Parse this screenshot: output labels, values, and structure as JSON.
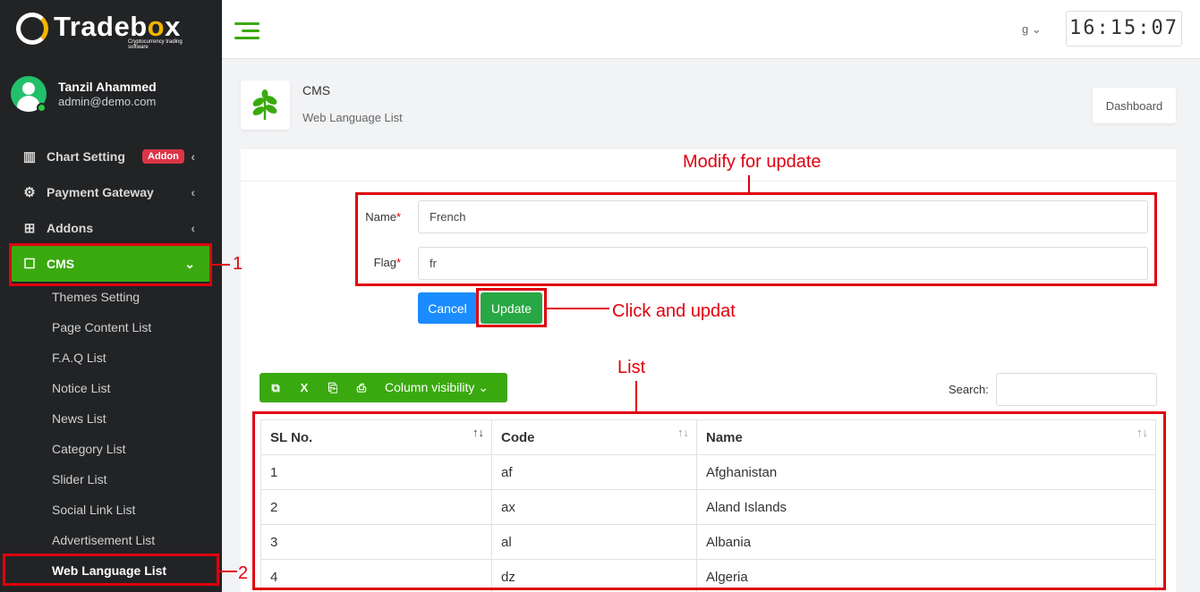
{
  "brand": {
    "name_part1": "Trade",
    "name_part2": "b",
    "name_o": "o",
    "name_part3": "x",
    "tagline": "Cryptocurrency trading software"
  },
  "user": {
    "name": "Tanzil Ahammed",
    "email": "admin@demo.com"
  },
  "sidebar": {
    "items": [
      {
        "label": "Chart Setting",
        "icon": "chart-icon",
        "badge": "Addon"
      },
      {
        "label": "Payment Gateway",
        "icon": "gears-icon"
      },
      {
        "label": "Addons",
        "icon": "sitemap-icon"
      },
      {
        "label": "CMS",
        "icon": "message-icon"
      }
    ],
    "cms_sub": [
      "Themes Setting",
      "Page Content List",
      "F.A.Q List",
      "Notice List",
      "News List",
      "Category List",
      "Slider List",
      "Social Link List",
      "Advertisement List",
      "Web Language List"
    ]
  },
  "topbar": {
    "lang": "g",
    "clock": "16:15:07"
  },
  "page": {
    "title": "CMS",
    "subtitle": "Web Language List",
    "dashboard_btn": "Dashboard"
  },
  "form": {
    "name_label": "Name",
    "name_value": "French",
    "flag_label": "Flag",
    "flag_value": "fr",
    "required_mark": "*",
    "cancel": "Cancel",
    "update": "Update"
  },
  "toolbar": {
    "column_visibility": "Column visibility"
  },
  "search": {
    "label": "Search:"
  },
  "table": {
    "headers": [
      "SL No.",
      "Code",
      "Name"
    ],
    "rows": [
      [
        "1",
        "af",
        "Afghanistan"
      ],
      [
        "2",
        "ax",
        "Aland Islands"
      ],
      [
        "3",
        "al",
        "Albania"
      ],
      [
        "4",
        "dz",
        "Algeria"
      ]
    ]
  },
  "annotations": {
    "modify": "Modify for update",
    "click": "Click and updat",
    "list": "List",
    "step1": "1",
    "step2": "2"
  },
  "colors": {
    "sidebar_bg": "#222325",
    "accent_green": "#3aa90f",
    "annotation_red": "#e0000f",
    "cancel_blue": "#1a8cff"
  }
}
